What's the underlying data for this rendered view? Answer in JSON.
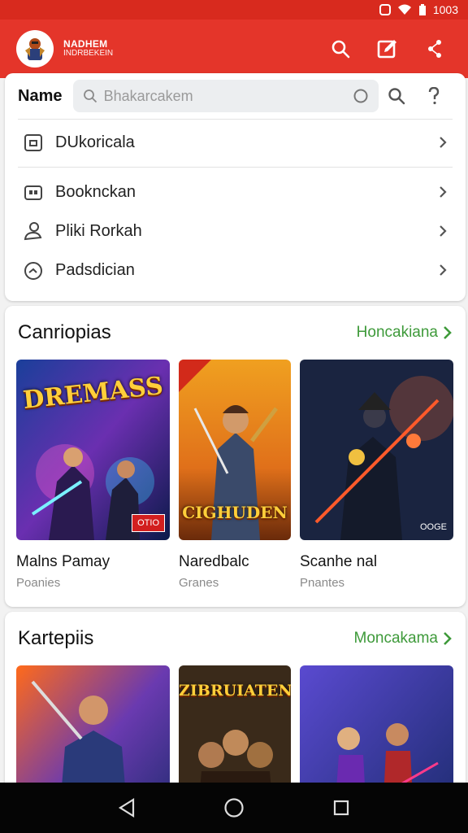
{
  "status": {
    "time": "1003"
  },
  "appbar": {
    "brand_line1": "NADHEM",
    "brand_line2": "INDRBEKEIN",
    "icons": [
      "search-icon",
      "edit-icon",
      "share-icon"
    ]
  },
  "search": {
    "label": "Name",
    "placeholder": "Bhakarcakem"
  },
  "menu": [
    {
      "label": "DUkoricala",
      "icon": "calendar-icon"
    },
    {
      "label": "Booknckan",
      "icon": "briefcase-icon"
    },
    {
      "label": "Pliki Rorkah",
      "icon": "user-icon"
    },
    {
      "label": "Padsdician",
      "icon": "timer-icon"
    }
  ],
  "sections": [
    {
      "title": "Canriopias",
      "more": "Honcakiana",
      "tiles": [
        {
          "name": "Malns Pamay",
          "sub": "Poanies",
          "art_text": "DREMASS",
          "badge": "OTIO"
        },
        {
          "name": "Naredbalc",
          "sub": "Granes",
          "art_text": "CIGHUDEN"
        },
        {
          "name": "Scanhe nal",
          "sub": "Pnantes",
          "badge": "OOGE"
        }
      ]
    },
    {
      "title": "Kartepiis",
      "more": "Moncakama",
      "tiles": [
        {
          "name": "",
          "sub": ""
        },
        {
          "name": "",
          "sub": "",
          "art_text": "ZIBRUIATEN"
        },
        {
          "name": "",
          "sub": ""
        }
      ]
    }
  ],
  "colors": {
    "accent": "#e4352a",
    "link": "#3e9a3a"
  }
}
